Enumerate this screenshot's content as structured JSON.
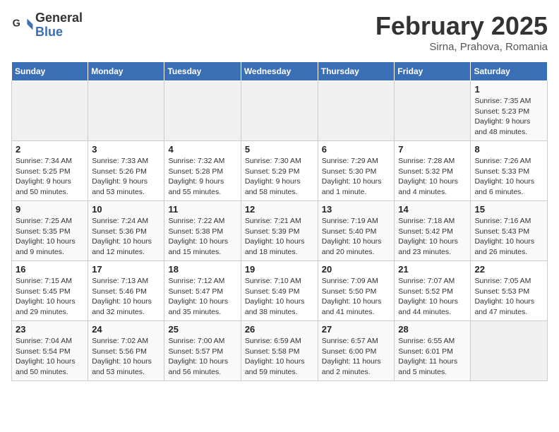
{
  "header": {
    "logo_general": "General",
    "logo_blue": "Blue",
    "month_title": "February 2025",
    "location": "Sirna, Prahova, Romania"
  },
  "days_of_week": [
    "Sunday",
    "Monday",
    "Tuesday",
    "Wednesday",
    "Thursday",
    "Friday",
    "Saturday"
  ],
  "weeks": [
    [
      {
        "day": "",
        "info": ""
      },
      {
        "day": "",
        "info": ""
      },
      {
        "day": "",
        "info": ""
      },
      {
        "day": "",
        "info": ""
      },
      {
        "day": "",
        "info": ""
      },
      {
        "day": "",
        "info": ""
      },
      {
        "day": "1",
        "info": "Sunrise: 7:35 AM\nSunset: 5:23 PM\nDaylight: 9 hours\nand 48 minutes."
      }
    ],
    [
      {
        "day": "2",
        "info": "Sunrise: 7:34 AM\nSunset: 5:25 PM\nDaylight: 9 hours\nand 50 minutes."
      },
      {
        "day": "3",
        "info": "Sunrise: 7:33 AM\nSunset: 5:26 PM\nDaylight: 9 hours\nand 53 minutes."
      },
      {
        "day": "4",
        "info": "Sunrise: 7:32 AM\nSunset: 5:28 PM\nDaylight: 9 hours\nand 55 minutes."
      },
      {
        "day": "5",
        "info": "Sunrise: 7:30 AM\nSunset: 5:29 PM\nDaylight: 9 hours\nand 58 minutes."
      },
      {
        "day": "6",
        "info": "Sunrise: 7:29 AM\nSunset: 5:30 PM\nDaylight: 10 hours\nand 1 minute."
      },
      {
        "day": "7",
        "info": "Sunrise: 7:28 AM\nSunset: 5:32 PM\nDaylight: 10 hours\nand 4 minutes."
      },
      {
        "day": "8",
        "info": "Sunrise: 7:26 AM\nSunset: 5:33 PM\nDaylight: 10 hours\nand 6 minutes."
      }
    ],
    [
      {
        "day": "9",
        "info": "Sunrise: 7:25 AM\nSunset: 5:35 PM\nDaylight: 10 hours\nand 9 minutes."
      },
      {
        "day": "10",
        "info": "Sunrise: 7:24 AM\nSunset: 5:36 PM\nDaylight: 10 hours\nand 12 minutes."
      },
      {
        "day": "11",
        "info": "Sunrise: 7:22 AM\nSunset: 5:38 PM\nDaylight: 10 hours\nand 15 minutes."
      },
      {
        "day": "12",
        "info": "Sunrise: 7:21 AM\nSunset: 5:39 PM\nDaylight: 10 hours\nand 18 minutes."
      },
      {
        "day": "13",
        "info": "Sunrise: 7:19 AM\nSunset: 5:40 PM\nDaylight: 10 hours\nand 20 minutes."
      },
      {
        "day": "14",
        "info": "Sunrise: 7:18 AM\nSunset: 5:42 PM\nDaylight: 10 hours\nand 23 minutes."
      },
      {
        "day": "15",
        "info": "Sunrise: 7:16 AM\nSunset: 5:43 PM\nDaylight: 10 hours\nand 26 minutes."
      }
    ],
    [
      {
        "day": "16",
        "info": "Sunrise: 7:15 AM\nSunset: 5:45 PM\nDaylight: 10 hours\nand 29 minutes."
      },
      {
        "day": "17",
        "info": "Sunrise: 7:13 AM\nSunset: 5:46 PM\nDaylight: 10 hours\nand 32 minutes."
      },
      {
        "day": "18",
        "info": "Sunrise: 7:12 AM\nSunset: 5:47 PM\nDaylight: 10 hours\nand 35 minutes."
      },
      {
        "day": "19",
        "info": "Sunrise: 7:10 AM\nSunset: 5:49 PM\nDaylight: 10 hours\nand 38 minutes."
      },
      {
        "day": "20",
        "info": "Sunrise: 7:09 AM\nSunset: 5:50 PM\nDaylight: 10 hours\nand 41 minutes."
      },
      {
        "day": "21",
        "info": "Sunrise: 7:07 AM\nSunset: 5:52 PM\nDaylight: 10 hours\nand 44 minutes."
      },
      {
        "day": "22",
        "info": "Sunrise: 7:05 AM\nSunset: 5:53 PM\nDaylight: 10 hours\nand 47 minutes."
      }
    ],
    [
      {
        "day": "23",
        "info": "Sunrise: 7:04 AM\nSunset: 5:54 PM\nDaylight: 10 hours\nand 50 minutes."
      },
      {
        "day": "24",
        "info": "Sunrise: 7:02 AM\nSunset: 5:56 PM\nDaylight: 10 hours\nand 53 minutes."
      },
      {
        "day": "25",
        "info": "Sunrise: 7:00 AM\nSunset: 5:57 PM\nDaylight: 10 hours\nand 56 minutes."
      },
      {
        "day": "26",
        "info": "Sunrise: 6:59 AM\nSunset: 5:58 PM\nDaylight: 10 hours\nand 59 minutes."
      },
      {
        "day": "27",
        "info": "Sunrise: 6:57 AM\nSunset: 6:00 PM\nDaylight: 11 hours\nand 2 minutes."
      },
      {
        "day": "28",
        "info": "Sunrise: 6:55 AM\nSunset: 6:01 PM\nDaylight: 11 hours\nand 5 minutes."
      },
      {
        "day": "",
        "info": ""
      }
    ]
  ]
}
